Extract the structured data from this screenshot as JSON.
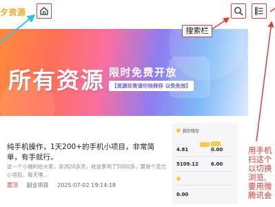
{
  "header": {
    "logo_text": "夕资源",
    "home_icon": "home-icon",
    "search_icon": "search-icon",
    "menu_icon": "list-menu-icon"
  },
  "annotations": {
    "search_label": "搜索栏",
    "side_note": "用手机\n扫这个\n以切换\n浏览,\n要用微\n腾讯会"
  },
  "banner": {
    "title": "所有资源",
    "tag": "限时免费开放",
    "subtitle": "【资源珍贵请尽快转存 以免失效】"
  },
  "article": {
    "title": "纯手机操作，1天200+的手机小项目，非常简单，有手就行。",
    "excerpt": "这一个小福利给大家，亲测20多天，收益拿到了5000多，算是个苦力小项目，每天埋...",
    "category": "置顶",
    "subcategory": "副业项目",
    "date": "2025-07-02 19:14:18"
  },
  "widget": {
    "section_title": "我的钱包",
    "balance_value": "4.81",
    "points_value": "0.00",
    "total_value": "5109.12",
    "coins_value": "6.00",
    "bottom_value": "0.00"
  },
  "colors": {
    "annotation_red": "#e53935",
    "logo_orange": "#f2a81d",
    "logo_green": "#8fcf3a",
    "banner_purple": "#6b5be0"
  }
}
